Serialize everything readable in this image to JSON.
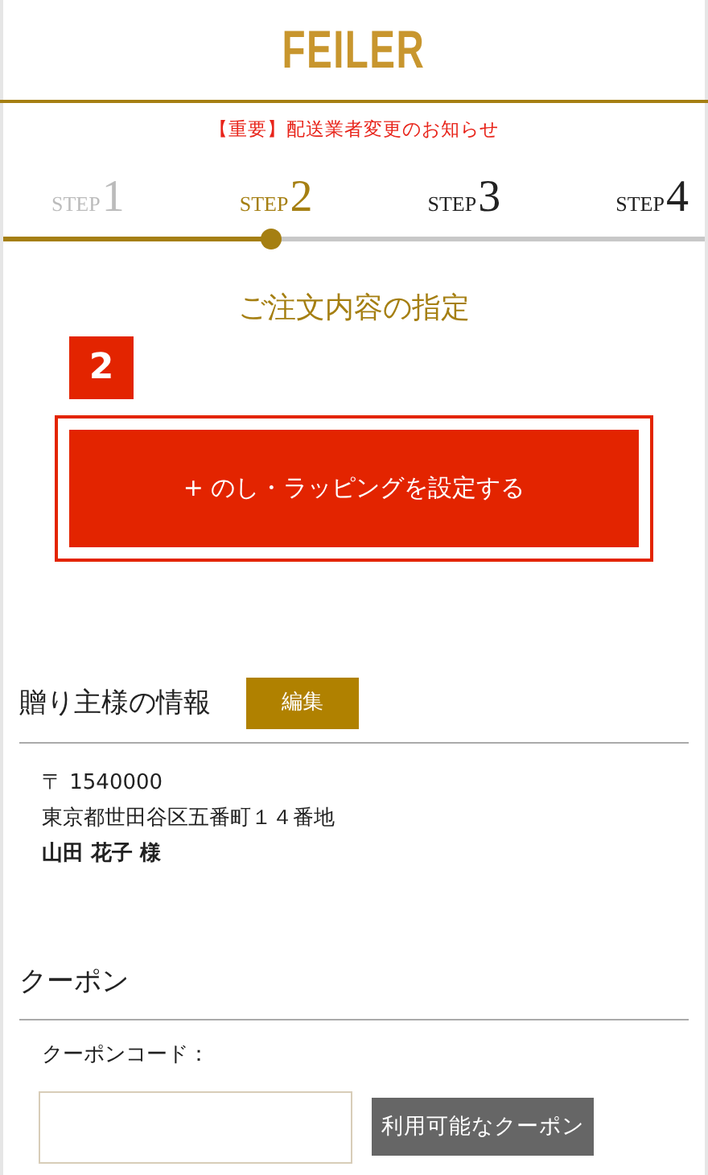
{
  "logo": "FEILER",
  "notice": "【重要】配送業者変更のお知らせ",
  "steps": [
    {
      "label": "STEP",
      "number": "1",
      "completed": true,
      "selected": false
    },
    {
      "label": "STEP",
      "number": "2",
      "completed": false,
      "selected": true
    },
    {
      "label": "STEP",
      "number": "3",
      "completed": false,
      "selected": false
    },
    {
      "label": "STEP",
      "number": "4",
      "completed": false,
      "selected": false
    }
  ],
  "progress": {
    "level": 0.38
  },
  "page_title": "ご注文内容の指定",
  "step_badge": "2",
  "wrapping_button": "+ のし・ラッピングを設定する",
  "sender": {
    "heading": "贈り主様の情報",
    "edit_button": "編集",
    "postal": "〒 1540000",
    "address": "東京都世田谷区五番町１４番地",
    "name": "山田 花子 様"
  },
  "coupon": {
    "heading": "クーポン",
    "label": "クーポンコード：",
    "button": "利用可能なクーポン"
  }
}
